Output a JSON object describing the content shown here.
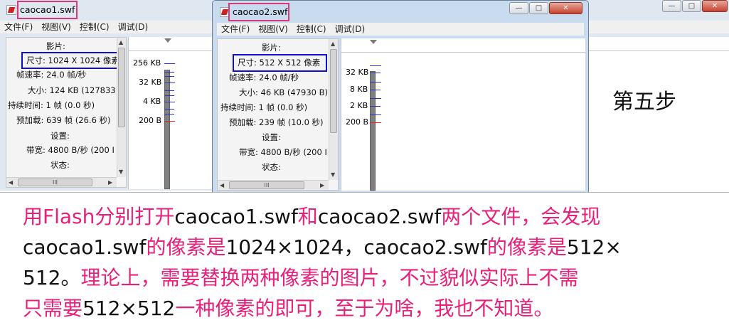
{
  "window1": {
    "title": "caocao1.swf",
    "menu": [
      "文件(F)",
      "视图(V)",
      "控制(C)",
      "调试(D)"
    ],
    "panel": {
      "header_movie": "影片:",
      "size": "尺寸: 1024 X 1024 像素",
      "framerate": "帧速率: 24.0 帧/秒",
      "filesize": "大小: 124 KB (127833",
      "duration": "持续时间: 1 帧 (0.0 秒)",
      "preload": "预加载: 639 帧 (26.6 秒)",
      "header_settings": "设置:",
      "bandwidth": "带宽: 4800 B/秒 (200 I",
      "header_state": "状态:"
    },
    "graph_labels": [
      "256 KB",
      "32 KB",
      "4 KB",
      "200 B"
    ]
  },
  "window2": {
    "title": "caocao2.swf",
    "menu": [
      "文件(F)",
      "视图(V)",
      "控制(C)",
      "调试(D)"
    ],
    "panel": {
      "header_movie": "影片:",
      "size": "尺寸: 512 X 512 像素",
      "framerate": "帧速率: 24.0 帧/秒",
      "filesize": "大小: 46 KB (47930 B)",
      "duration": "持续时间: 1 帧 (0.0 秒)",
      "preload": "预加载: 239 帧 (10.0 秒)",
      "header_settings": "设置:",
      "bandwidth": "带宽: 4800 B/秒 (200 I",
      "header_state": "状态:"
    },
    "graph_labels": [
      "32 KB",
      "8 KB",
      "2 KB",
      "200 B"
    ],
    "buttons": {
      "minimize": "—",
      "maximize": "□",
      "close": "✕"
    }
  },
  "window3": {
    "buttons": {
      "minimize": "—",
      "maximize": "□",
      "close": "✕"
    }
  },
  "step_label": "第五步",
  "note": {
    "line1_a": "用Flash分别打开",
    "line1_b": "caocao1.swf",
    "line1_c": "和",
    "line1_d": "caocao2.swf",
    "line1_e": "两个文件，会发现",
    "line2_a": "caocao1.swf",
    "line2_b": "的像素是",
    "line2_c": "1024×1024，caocao2.swf",
    "line2_d": "的像素是",
    "line2_e": "512×",
    "line3_a": "512。",
    "line3_b": "理论上，需要替换两种像素的图片，不过貌似实际上不需",
    "line4_a": "只需要",
    "line4_b": "512×512",
    "line4_c": "一种像素的即可，至于为啥，我也不知道。"
  },
  "colors": {
    "note_accent": "#e8207a",
    "size_highlight": "#1010cc",
    "title_highlight": "#d83a78"
  }
}
